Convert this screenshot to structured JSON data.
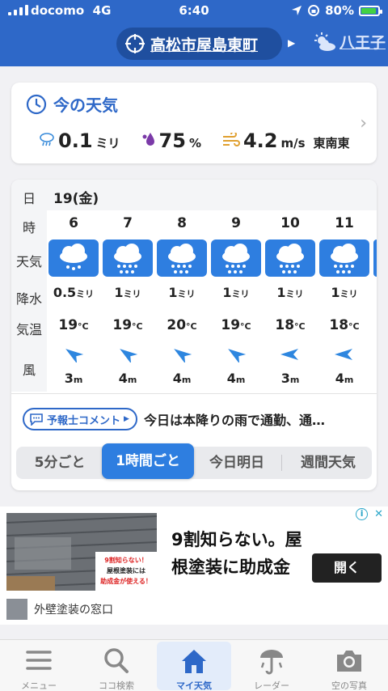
{
  "status_bar": {
    "carrier": "docomo",
    "network": "4G",
    "time": "6:40",
    "battery": "80%",
    "battery_level": 0.8
  },
  "header": {
    "current_location": "高松市屋島東町",
    "next_location": "八王子"
  },
  "now": {
    "title": "今の天気",
    "precip_value": "0.1",
    "precip_unit": "ミリ",
    "humidity_value": "75",
    "humidity_unit": "%",
    "wind_value": "4.2",
    "wind_unit": "m/s",
    "wind_dir": "東南東"
  },
  "hourly": {
    "row_labels": {
      "day": "日",
      "hour": "時",
      "weather": "天気",
      "precip": "降水",
      "temp": "気温",
      "wind": "風"
    },
    "date": "19(金)",
    "columns": [
      {
        "hour": "6",
        "weather": "rain-icon",
        "precip": "0.5",
        "precip_unit": "ミリ",
        "temp": "19",
        "temp_unit": "°C",
        "wind_dir": "northwest-arrow-icon",
        "wind_speed": "3",
        "wind_unit": "m"
      },
      {
        "hour": "7",
        "weather": "heavy-rain-icon",
        "precip": "1",
        "precip_unit": "ミリ",
        "temp": "19",
        "temp_unit": "°C",
        "wind_dir": "northwest-arrow-icon",
        "wind_speed": "4",
        "wind_unit": "m"
      },
      {
        "hour": "8",
        "weather": "heavy-rain-icon",
        "precip": "1",
        "precip_unit": "ミリ",
        "temp": "20",
        "temp_unit": "°C",
        "wind_dir": "northwest-arrow-icon",
        "wind_speed": "4",
        "wind_unit": "m"
      },
      {
        "hour": "9",
        "weather": "heavy-rain-icon",
        "precip": "1",
        "precip_unit": "ミリ",
        "temp": "19",
        "temp_unit": "°C",
        "wind_dir": "northwest-arrow-icon",
        "wind_speed": "4",
        "wind_unit": "m"
      },
      {
        "hour": "10",
        "weather": "heavy-rain-icon",
        "precip": "1",
        "precip_unit": "ミリ",
        "temp": "18",
        "temp_unit": "°C",
        "wind_dir": "west-arrow-icon",
        "wind_speed": "3",
        "wind_unit": "m"
      },
      {
        "hour": "11",
        "weather": "heavy-rain-icon",
        "precip": "1",
        "precip_unit": "ミリ",
        "temp": "18",
        "temp_unit": "°C",
        "wind_dir": "west-arrow-icon",
        "wind_speed": "4",
        "wind_unit": "m"
      }
    ],
    "forecaster_label": "予報士コメント",
    "forecaster_comment": "今日は本降りの雨で通勤、通…",
    "tabs": [
      "5分ごと",
      "1時間ごと",
      "今日明日",
      "週間天気"
    ],
    "active_tab": "1時間ごと"
  },
  "ad": {
    "headline": "9割知らない。屋根塗装に助成金",
    "image_text_1": "9割知らない！",
    "image_text_2": "屋根塗装には",
    "image_text_3": "助成金が使える！",
    "cta": "開く",
    "advertiser": "外壁塗装の窓口"
  },
  "nav": {
    "items": [
      {
        "label": "メニュー",
        "icon": "menu-icon"
      },
      {
        "label": "ココ検索",
        "icon": "search-icon"
      },
      {
        "label": "マイ天気",
        "icon": "home-icon"
      },
      {
        "label": "レーダー",
        "icon": "radar-icon"
      },
      {
        "label": "空の写真",
        "icon": "camera-icon"
      }
    ],
    "active": "マイ天気"
  },
  "colors": {
    "primary": "#2e68c8",
    "weather_tile": "#2e7ee0",
    "header_pill": "#1f4f9f"
  }
}
